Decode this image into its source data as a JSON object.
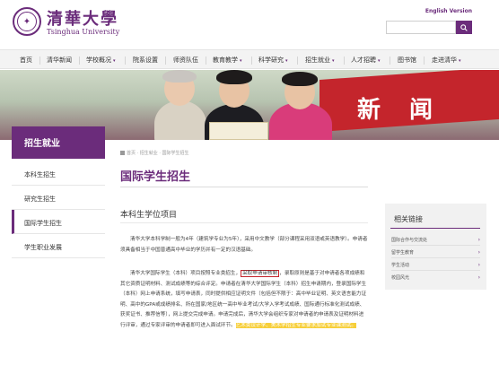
{
  "header": {
    "logo_cn": "清華大學",
    "logo_en": "Tsinghua University",
    "english_version": "English Version",
    "search_placeholder": ""
  },
  "nav": {
    "items": [
      {
        "label": "首页",
        "has_menu": false
      },
      {
        "label": "清华新闻",
        "has_menu": false
      },
      {
        "label": "学校概况",
        "has_menu": true
      },
      {
        "label": "院系设置",
        "has_menu": false
      },
      {
        "label": "师资队伍",
        "has_menu": false
      },
      {
        "label": "教育教学",
        "has_menu": true
      },
      {
        "label": "科学研究",
        "has_menu": true
      },
      {
        "label": "招生就业",
        "has_menu": true
      },
      {
        "label": "人才招聘",
        "has_menu": true
      },
      {
        "label": "图书馆",
        "has_menu": false
      },
      {
        "label": "走进清华",
        "has_menu": true
      }
    ],
    "arrow": "▾"
  },
  "banner": {
    "text_a": "新",
    "text_b": "闻"
  },
  "sidebar": {
    "title": "招生就业",
    "items": [
      {
        "label": "本科生招生"
      },
      {
        "label": "研究生招生"
      },
      {
        "label": "国际学生招生"
      },
      {
        "label": "学生职业发展"
      }
    ],
    "active_index": 2
  },
  "breadcrumb": "首页 · 招生就业 · 国际学生招生",
  "main": {
    "title": "国际学生招生",
    "subtitle": "本科生学位项目",
    "para1": "清华大学本科学制一般为4年（建筑学专业为5年），采用中文教学（部分课程采用双语或英语教学）。申请者须具备相当于中国普通高中毕业的学历并有一定的汉语基础。",
    "para2_a": "清华大学国际学生（本科）项目按照专业类招生，",
    "para2_boxed": "采取申请审核制",
    "para2_b": "，录取原则是基于对申请者各项成绩和其它资质证明材料、测试成绩等的综合评定。申请者在清华大学国际学生（本科）招生申请期内，登录国际学生（本科）网上申请系统，填写申请表，同时提供相应证明文件（包括但不限于：高中毕业证明、英文语言能力证明、高中的GPA或成绩排名、所在国家/地区统一高中毕业考试/大学入学考试成绩、国际通行标准化测试成绩、获奖证书、推荐信等），网上提交完成申请。申请完成后，清华大学会组织专家对申请者的申请表及证明材料进行评审，通过专家评审的申请者即可进入面试环节。",
    "para2_hl": "艺术类设计学、美术学招生专业要求加试专业课测试。"
  },
  "aside": {
    "title": "相关链接",
    "links": [
      {
        "label": "国际合作与交流处"
      },
      {
        "label": "留学生教育"
      },
      {
        "label": "学生活动"
      },
      {
        "label": "校园风光"
      }
    ],
    "chevron": "›"
  },
  "colors": {
    "brand_purple": "#6b2c7b",
    "highlight_yellow": "#f7cf3a",
    "box_red": "#c4252c"
  }
}
